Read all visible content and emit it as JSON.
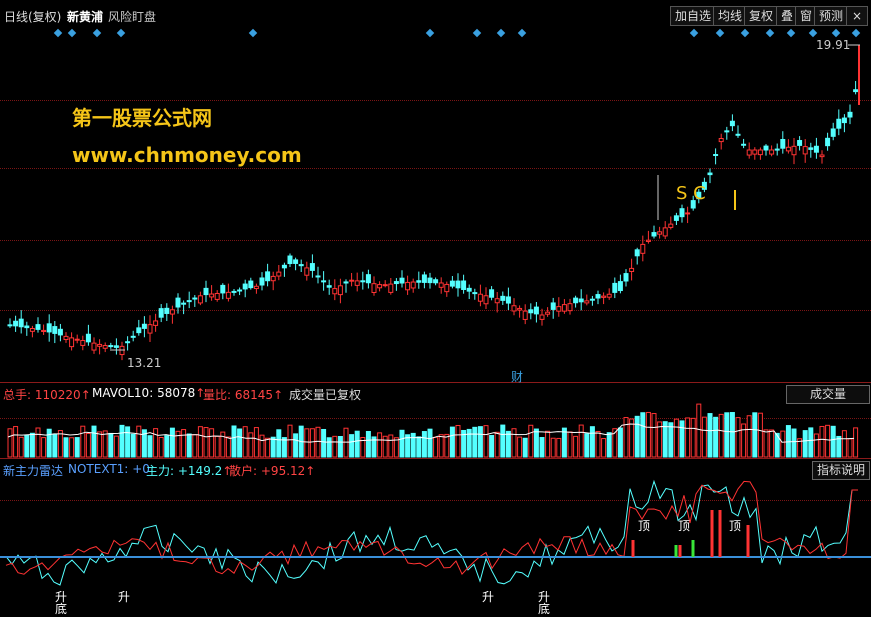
{
  "header": {
    "period": "日线(复权)",
    "stock_name": "新黄浦",
    "mode": "风险盯盘",
    "buttons": [
      "加自选",
      "均线",
      "复权",
      "叠",
      "窗",
      "预测"
    ],
    "close_icon": "close-icon"
  },
  "watermark": {
    "line1": "第一股票公式网",
    "line2": "www.chnmoney.com"
  },
  "price_panel": {
    "high_label": "19.91",
    "low_label": "13.21",
    "sc_mark": "S C",
    "bottom_marker": "财"
  },
  "volume_panel": {
    "total_label": "总手:",
    "total_value": "110220",
    "mavol_label": "MAVOL10:",
    "mavol_value": "58078",
    "ratio_label": "量比:",
    "ratio_value": "68145",
    "note": "成交量已复权",
    "button": "成交量"
  },
  "indicator_panel": {
    "name": "新主力雷达",
    "notext_label": "NOTEXT1:",
    "notext_value": "+0",
    "main_label": "主力:",
    "main_value": "+149.2",
    "retail_label": "散户:",
    "retail_value": "+95.12",
    "button": "指标说明",
    "marks_top": [
      "顶",
      "顶",
      "顶"
    ],
    "marks_bottom": [
      "升",
      "底",
      "升",
      "升",
      "升",
      "底"
    ]
  },
  "colors": {
    "up": "#ff3333",
    "down": "#54ffff",
    "accent_yellow": "#f5c518",
    "axis": "#8b1a1a",
    "blue_line": "#3a8fd9"
  }
}
